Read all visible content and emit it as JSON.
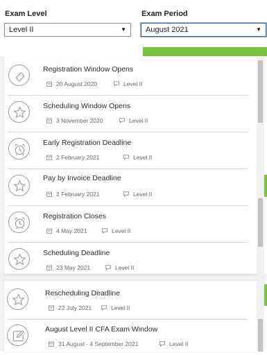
{
  "filters": {
    "exam_level": {
      "label": "Exam Level",
      "value": "Level II"
    },
    "exam_period": {
      "label": "Exam Period",
      "value": "August 2021"
    }
  },
  "events": [
    {
      "title": "Registration Window Opens",
      "date": "20 August 2020",
      "level": "Level II",
      "icon": "ticket-icon"
    },
    {
      "title": "Scheduling Window Opens",
      "date": "3 November 2020",
      "level": "Level II",
      "icon": "star-icon"
    },
    {
      "title": "Early Registration Deadline",
      "date": "2 February 2021",
      "level": "Level II",
      "icon": "alarm-clock-icon"
    },
    {
      "title": "Pay by Invoice Deadline",
      "date": "2 February 2021",
      "level": "Level II",
      "icon": "star-icon"
    },
    {
      "title": "Registration Closes",
      "date": "4 May 2021",
      "level": "Level II",
      "icon": "alarm-clock-icon"
    },
    {
      "title": "Scheduling Deadline",
      "date": "23 May 2021",
      "level": "Level II",
      "icon": "star-icon"
    },
    {
      "title": "Rescheduling Deadline",
      "date": "22 July 2021",
      "level": "Level II",
      "icon": "star-icon"
    },
    {
      "title": "August Level II CFA Exam Window",
      "date": "31 August - 4 September 2021",
      "level": "Level II",
      "icon": "edit-icon"
    }
  ],
  "colors": {
    "accent_green": "#7bc142",
    "divider": "#d9d9d9",
    "icon_stroke": "#9a9a9a"
  }
}
